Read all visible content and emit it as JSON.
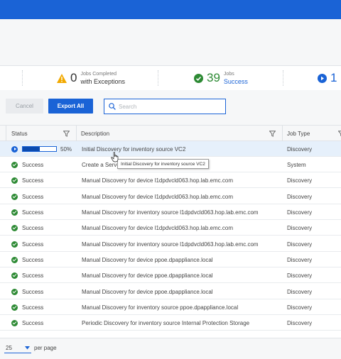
{
  "stats": {
    "exceptions": {
      "count": "0",
      "small": "Jobs Completed",
      "main": "with Exceptions"
    },
    "success": {
      "count": "39",
      "small": "Jobs",
      "main": "Success"
    },
    "running": {
      "count": "1"
    }
  },
  "toolbar": {
    "cancel_label": "Cancel",
    "export_label": "Export All",
    "search_placeholder": "Search"
  },
  "columns": {
    "status": "Status",
    "description": "Description",
    "job_type": "Job Type"
  },
  "rows": [
    {
      "status": "50%",
      "progress": 0.5,
      "description": "Initial Discovery for inventory source VC2",
      "job_type": "Discovery"
    },
    {
      "status": "Success",
      "description": "Create a Serve",
      "job_type": "System"
    },
    {
      "status": "Success",
      "description": "Manual Discovery for device l1dpdvcld063.hop.lab.emc.com",
      "job_type": "Discovery"
    },
    {
      "status": "Success",
      "description": "Manual Discovery for device l1dpdvcld063.hop.lab.emc.com",
      "job_type": "Discovery"
    },
    {
      "status": "Success",
      "description": "Manual Discovery for inventory source l1dpdvcld063.hop.lab.emc.com",
      "job_type": "Discovery"
    },
    {
      "status": "Success",
      "description": "Manual Discovery for device l1dpdvcld063.hop.lab.emc.com",
      "job_type": "Discovery"
    },
    {
      "status": "Success",
      "description": "Manual Discovery for inventory source l1dpdvcld063.hop.lab.emc.com",
      "job_type": "Discovery"
    },
    {
      "status": "Success",
      "description": "Manual Discovery for device ppoe.dpappliance.local",
      "job_type": "Discovery"
    },
    {
      "status": "Success",
      "description": "Manual Discovery for device ppoe.dpappliance.local",
      "job_type": "Discovery"
    },
    {
      "status": "Success",
      "description": "Manual Discovery for device ppoe.dpappliance.local",
      "job_type": "Discovery"
    },
    {
      "status": "Success",
      "description": "Manual Discovery for inventory source ppoe.dpappliance.local",
      "job_type": "Discovery"
    },
    {
      "status": "Success",
      "description": "Periodic Discovery for inventory source Internal Protection Storage",
      "job_type": "Discovery"
    }
  ],
  "tooltip": "Initial Discovery for inventory source VC2",
  "footer": {
    "per_page_value": "25",
    "per_page_label": "per page"
  }
}
